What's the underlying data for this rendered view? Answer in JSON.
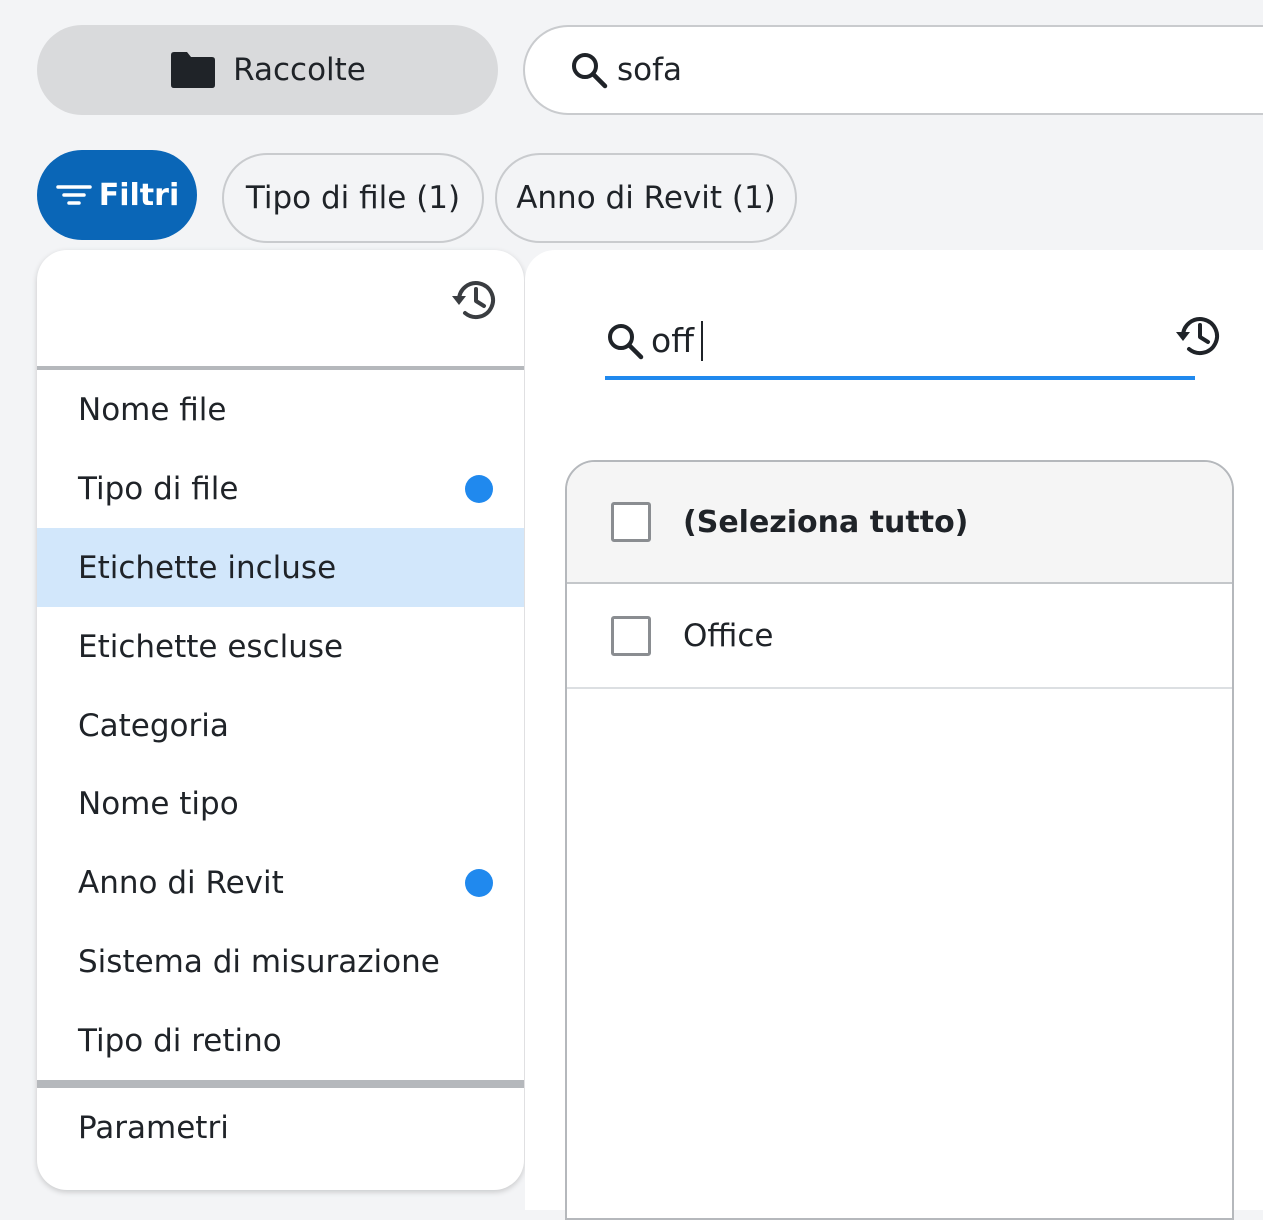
{
  "topbar": {
    "collections_label": "Raccolte",
    "search_value": "sofa"
  },
  "filters": {
    "button_label": "Filtri",
    "chips": [
      {
        "label": "Tipo di file (1)"
      },
      {
        "label": "Anno di Revit (1)"
      }
    ]
  },
  "left_panel": {
    "items": [
      {
        "label": "Nome file",
        "has_dot": false,
        "active": false
      },
      {
        "label": "Tipo di file",
        "has_dot": true,
        "active": false
      },
      {
        "label": "Etichette incluse",
        "has_dot": false,
        "active": true
      },
      {
        "label": "Etichette escluse",
        "has_dot": false,
        "active": false
      },
      {
        "label": "Categoria",
        "has_dot": false,
        "active": false
      },
      {
        "label": "Nome tipo",
        "has_dot": false,
        "active": false
      },
      {
        "label": "Anno di Revit",
        "has_dot": true,
        "active": false
      },
      {
        "label": "Sistema di misurazione",
        "has_dot": false,
        "active": false
      },
      {
        "label": "Tipo di retino",
        "has_dot": false,
        "active": false
      }
    ],
    "footer_item": "Parametri"
  },
  "right_panel": {
    "search_value": "off",
    "select_all_label": "(Seleziona tutto)",
    "options": [
      {
        "label": "Office",
        "checked": false
      }
    ]
  },
  "colors": {
    "accent": "#0a66b7",
    "active_row": "#d2e7fb",
    "dot": "#2089ee"
  },
  "icons": [
    "folder-icon",
    "search-icon",
    "filter-icon",
    "history-icon",
    "checkbox-icon"
  ]
}
